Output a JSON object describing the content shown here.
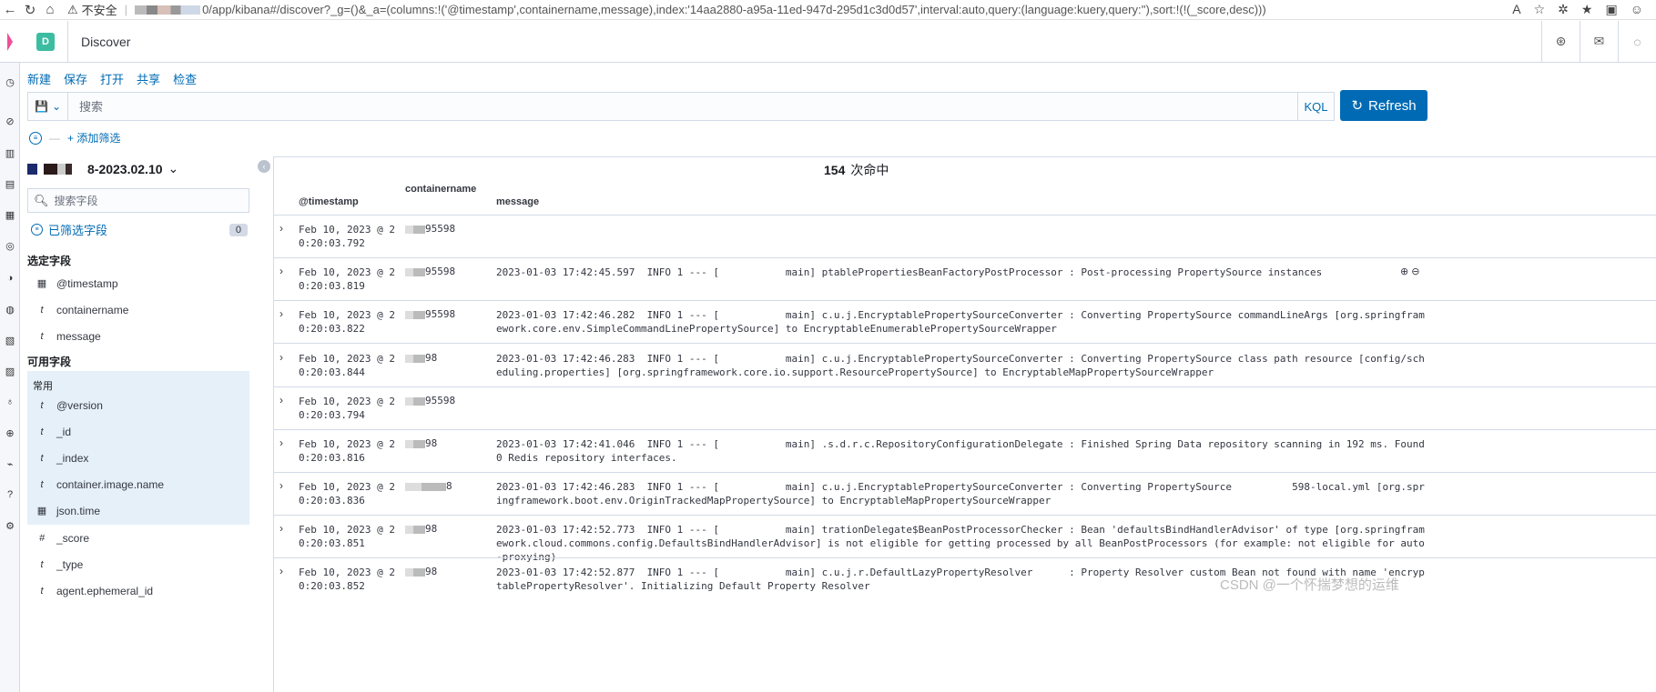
{
  "browser": {
    "insecure_label": "不安全",
    "url": "0/app/kibana#/discover?_g=()&_a=(columns:!('@timestamp',containername,message),index:'14aa2880-a95a-11ed-947d-295d1c3d0d57',interval:auto,query:(language:kuery,query:''),sort:!(!(_score,desc)))"
  },
  "header": {
    "space_initial": "D",
    "app_title": "Discover"
  },
  "topnav": [
    "新建",
    "保存",
    "打开",
    "共享",
    "检查"
  ],
  "query": {
    "placeholder": "搜索",
    "language": "KQL",
    "refresh_label": "Refresh"
  },
  "filters": {
    "add_label": "+ 添加筛选"
  },
  "sidebar": {
    "index_pattern": "8-2023.02.10",
    "field_search_placeholder": "搜索字段",
    "filtered_fields_label": "已筛选字段",
    "filtered_count": "0",
    "selected_header": "选定字段",
    "selected_fields": [
      {
        "type": "date",
        "name": "@timestamp"
      },
      {
        "type": "t",
        "name": "containername"
      },
      {
        "type": "t",
        "name": "message"
      }
    ],
    "available_header": "可用字段",
    "common_header": "常用",
    "available_fields": [
      {
        "type": "t",
        "name": "@version"
      },
      {
        "type": "t",
        "name": "_id"
      },
      {
        "type": "t",
        "name": "_index"
      },
      {
        "type": "t",
        "name": "container.image.name"
      },
      {
        "type": "date",
        "name": "json.time"
      },
      {
        "type": "#",
        "name": "_score"
      },
      {
        "type": "t",
        "name": "_type"
      },
      {
        "type": "t",
        "name": "agent.ephemeral_id"
      }
    ]
  },
  "results": {
    "hit_count": "154",
    "hit_label": "次命中",
    "columns": [
      "@timestamp",
      "containername",
      "message"
    ],
    "rows": [
      {
        "ts": "Feb 10, 2023 @ 2\n0:20:03.792",
        "cn": "95598",
        "msg": ""
      },
      {
        "ts": "Feb 10, 2023 @ 2\n0:20:03.819",
        "cn": "95598",
        "msg": "2023-01-03 17:42:45.597  INFO 1 --- [           main] ptablePropertiesBeanFactoryPostProcessor : Post-processing PropertySource instances"
      },
      {
        "ts": "Feb 10, 2023 @ 2\n0:20:03.822",
        "cn": "95598",
        "msg": "2023-01-03 17:42:46.282  INFO 1 --- [           main] c.u.j.EncryptablePropertySourceConverter : Converting PropertySource commandLineArgs [org.springframework.core.env.SimpleCommandLinePropertySource] to EncryptableEnumerablePropertySourceWrapper"
      },
      {
        "ts": "Feb 10, 2023 @ 2\n0:20:03.844",
        "cn": "98",
        "msg": "2023-01-03 17:42:46.283  INFO 1 --- [           main] c.u.j.EncryptablePropertySourceConverter : Converting PropertySource class path resource [config/scheduling.properties] [org.springframework.core.io.support.ResourcePropertySource] to EncryptableMapPropertySourceWrapper"
      },
      {
        "ts": "Feb 10, 2023 @ 2\n0:20:03.794",
        "cn": "95598",
        "msg": ""
      },
      {
        "ts": "Feb 10, 2023 @ 2\n0:20:03.816",
        "cn": "98",
        "msg": "2023-01-03 17:42:41.046  INFO 1 --- [           main] .s.d.r.c.RepositoryConfigurationDelegate : Finished Spring Data repository scanning in 192 ms. Found 0 Redis repository interfaces."
      },
      {
        "ts": "Feb 10, 2023 @ 2\n0:20:03.836",
        "cn": "8",
        "msg": "2023-01-03 17:42:46.283  INFO 1 --- [           main] c.u.j.EncryptablePropertySourceConverter : Converting PropertySource          598-local.yml [org.springframework.boot.env.OriginTrackedMapPropertySource] to EncryptableMapPropertySourceWrapper"
      },
      {
        "ts": "Feb 10, 2023 @ 2\n0:20:03.851",
        "cn": "98",
        "msg": "2023-01-03 17:42:52.773  INFO 1 --- [           main] trationDelegate$BeanPostProcessorChecker : Bean 'defaultsBindHandlerAdvisor' of type [org.springframework.cloud.commons.config.DefaultsBindHandlerAdvisor] is not eligible for getting processed by all BeanPostProcessors (for example: not eligible for auto-proxying)"
      },
      {
        "ts": "Feb 10, 2023 @ 2\n0:20:03.852",
        "cn": "98",
        "msg": "2023-01-03 17:42:52.877  INFO 1 --- [           main] c.u.j.r.DefaultLazyPropertyResolver      : Property Resolver custom Bean not found with name 'encryptablePropertyResolver'. Initializing Default Property Resolver"
      }
    ]
  },
  "watermark": "CSDN @一个怀揣梦想的运维"
}
